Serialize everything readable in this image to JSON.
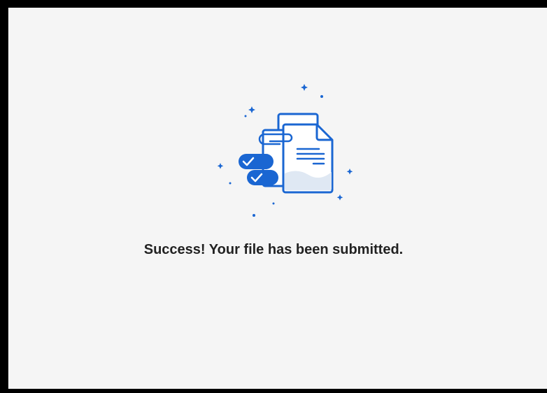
{
  "status": {
    "message": "Success! Your file has been submitted."
  },
  "illustration": {
    "icon": "documents-submitted-icon",
    "accent_color": "#1a66d2",
    "light_color": "#dfe8f3",
    "sparkle_color": "#1a66d2"
  },
  "colors": {
    "background": "#f5f5f5",
    "frame": "#000000",
    "text": "#222222"
  }
}
